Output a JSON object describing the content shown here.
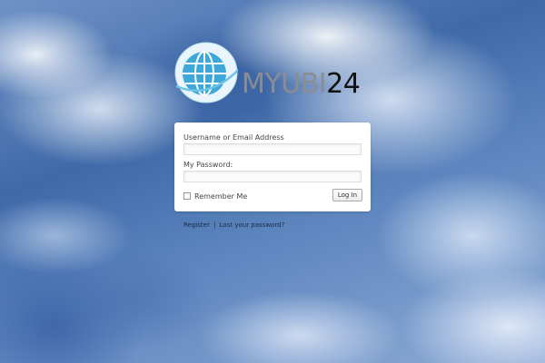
{
  "logo": {
    "text_light": "MYUBI",
    "text_dark": "24",
    "icon": "globe-icon",
    "colors": {
      "globe": "#3ea8d8",
      "globe_ring": "#6fc3ea",
      "text_light": "#8a8d92",
      "text_dark": "#111111"
    }
  },
  "login_form": {
    "username_label": "Username or Email Address",
    "username_value": "",
    "password_label": "My Password:",
    "password_value": "",
    "remember_label": "Remember Me",
    "remember_checked": false,
    "submit_label": "Log In"
  },
  "links": {
    "register": "Register",
    "separator": "|",
    "lost_password": "Lost your password?"
  }
}
